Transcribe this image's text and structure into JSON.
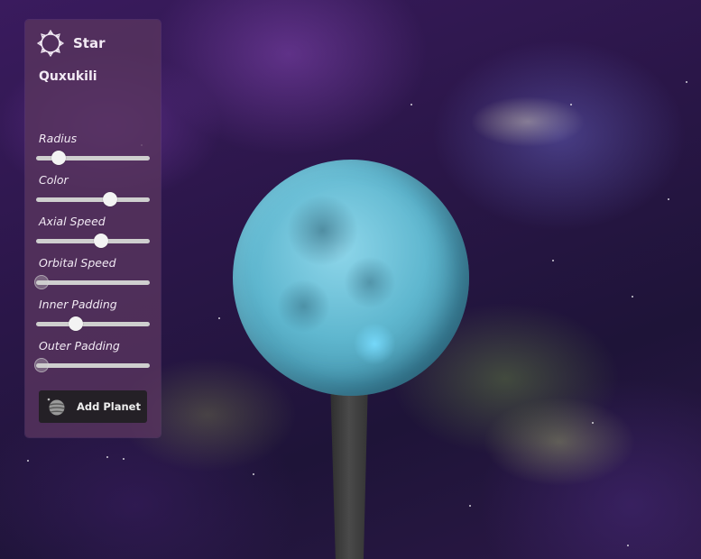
{
  "panel": {
    "header": {
      "title": "Star",
      "icon": "sun-icon"
    },
    "object_name": "Quxukili",
    "controls": [
      {
        "label": "Radius",
        "value": 0.2,
        "enabled": true
      },
      {
        "label": "Color",
        "value": 0.65,
        "enabled": true
      },
      {
        "label": "Axial Speed",
        "value": 0.57,
        "enabled": true
      },
      {
        "label": "Orbital Speed",
        "value": 0.05,
        "enabled": false
      },
      {
        "label": "Inner Padding",
        "value": 0.35,
        "enabled": true
      },
      {
        "label": "Outer Padding",
        "value": 0.05,
        "enabled": false
      }
    ],
    "add_button": {
      "label": "Add Planet",
      "icon": "planet-icon"
    }
  },
  "scene": {
    "planet_color": "#5fb7cf",
    "panel_color": "#58345e"
  }
}
